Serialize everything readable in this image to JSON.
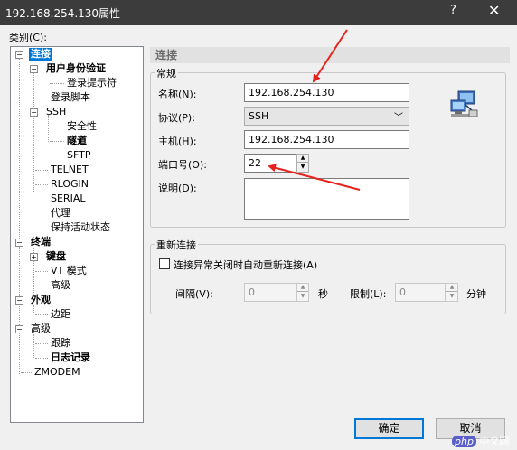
{
  "window": {
    "title": "192.168.254.130属性",
    "help_icon": "?",
    "close_icon": "✕"
  },
  "category_label": "类别(C):",
  "tree": {
    "connection": "连接",
    "user_auth": "用户身份验证",
    "login_prompt": "登录提示符",
    "login_script": "登录脚本",
    "ssh": "SSH",
    "security": "安全性",
    "tunnel": "隧道",
    "sftp": "SFTP",
    "telnet": "TELNET",
    "rlogin": "RLOGIN",
    "serial": "SERIAL",
    "proxy": "代理",
    "keepalive": "保持活动状态",
    "terminal": "终端",
    "keyboard": "键盘",
    "vt_mode": "VT 模式",
    "advanced_t": "高级",
    "appearance": "外观",
    "margin": "边距",
    "advanced": "高级",
    "trace": "跟踪",
    "logging": "日志记录",
    "zmodem": "ZMODEM"
  },
  "section_title": "连接",
  "general": {
    "title": "常规",
    "name_label": "名称(N):",
    "name_value": "192.168.254.130",
    "protocol_label": "协议(P):",
    "protocol_value": "SSH",
    "host_label": "主机(H):",
    "host_value": "192.168.254.130",
    "port_label": "端口号(O):",
    "port_value": "22",
    "desc_label": "说明(D):",
    "desc_value": ""
  },
  "reconnect": {
    "title": "重新连接",
    "checkbox_label": "连接异常关闭时自动重新连接(A)",
    "interval_label": "间隔(V):",
    "interval_value": "0",
    "seconds_label": "秒",
    "limit_label": "限制(L):",
    "limit_value": "0",
    "minutes_label": "分钟"
  },
  "buttons": {
    "ok": "确定",
    "cancel": "取消"
  },
  "watermark": {
    "php": "php",
    "text": "中文网"
  },
  "colors": {
    "selection": "#0078d7",
    "titlebar": "#3c3c3c",
    "arrow": "#e8221c"
  }
}
